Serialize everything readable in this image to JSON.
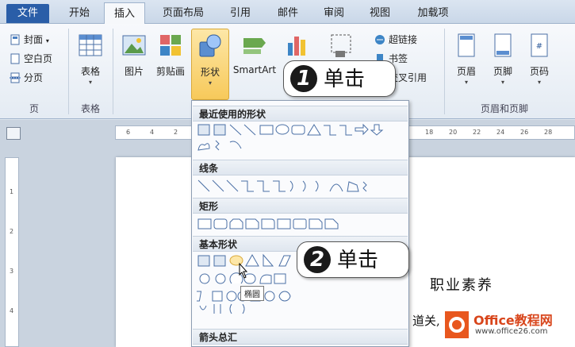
{
  "tabs": [
    "文件",
    "开始",
    "插入",
    "页面布局",
    "引用",
    "邮件",
    "审阅",
    "视图",
    "加载项"
  ],
  "ribbon": {
    "page_group": {
      "cover": "封面",
      "blank": "空白页",
      "break": "分页",
      "label": "页"
    },
    "table_group": {
      "table": "表格",
      "label": "表格"
    },
    "illustrations": {
      "picture": "图片",
      "clipart": "剪贴画",
      "shapes": "形状",
      "smartart": "SmartArt"
    },
    "links_group": {
      "hyperlink": "超链接",
      "bookmark": "书签",
      "crossref": "交叉引用"
    },
    "header_footer": {
      "header": "页眉",
      "footer": "页脚",
      "pagenum": "页码",
      "label": "页眉和页脚"
    }
  },
  "dropdown": {
    "recent": "最近使用的形状",
    "lines": "线条",
    "rect": "矩形",
    "basic": "基本形状",
    "arrows": "箭头总汇"
  },
  "tooltip": "椭圆",
  "callout1": {
    "num": "1",
    "text": "单击"
  },
  "callout2": {
    "num": "2",
    "text": "单击"
  },
  "document": {
    "title": "职业素养",
    "body_fragment": "道关,"
  },
  "ruler": {
    "h_left": [
      "6",
      "4",
      "2"
    ],
    "h_right": [
      "18",
      "20",
      "22",
      "24",
      "26",
      "28"
    ],
    "v": [
      "1",
      "2",
      "3",
      "4"
    ]
  },
  "logo": {
    "main": "Office教程网",
    "url": "www.office26.com"
  }
}
